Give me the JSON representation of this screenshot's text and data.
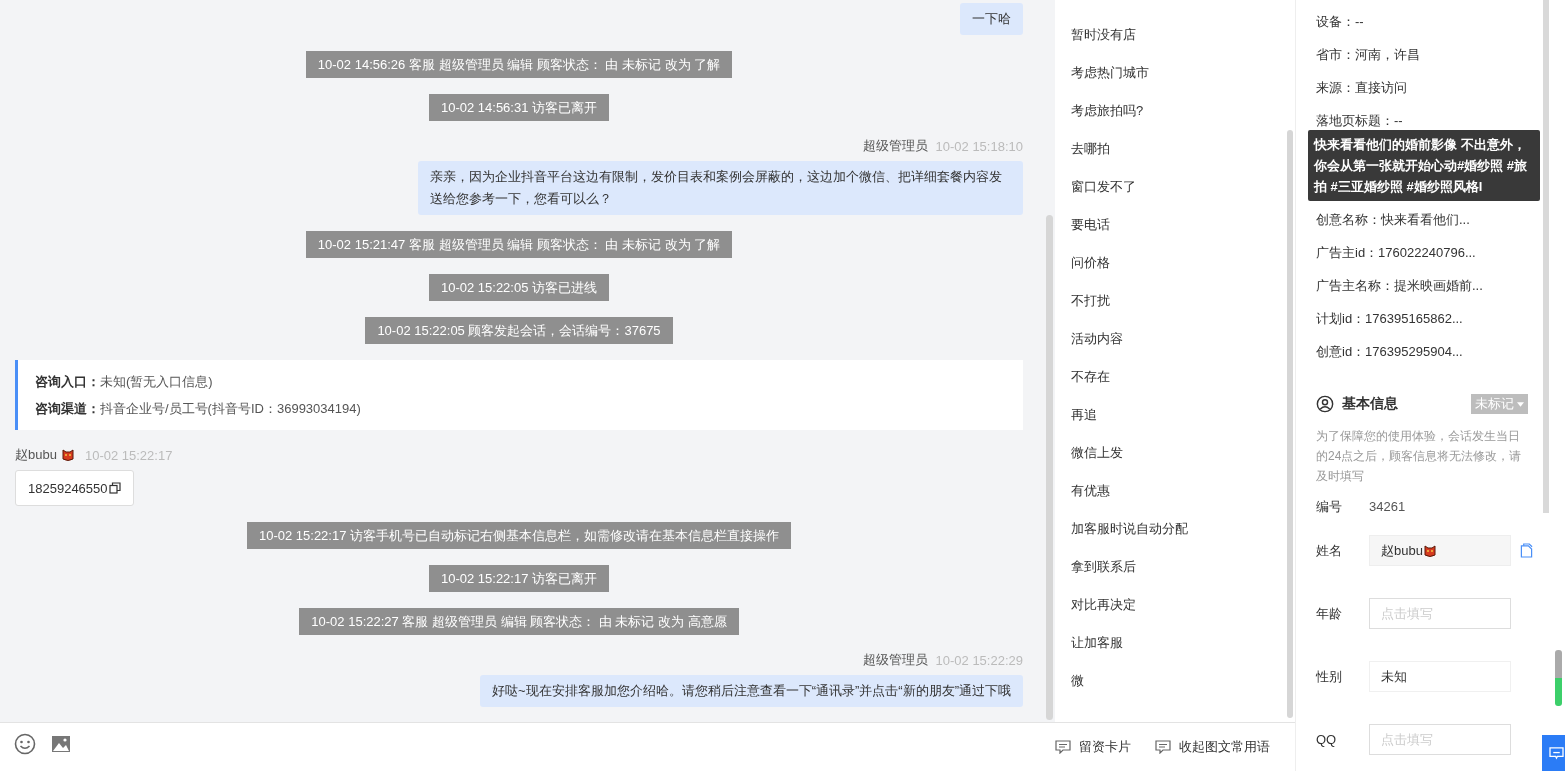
{
  "chat": {
    "messages": [
      {
        "kind": "agent",
        "text": "一下哈"
      },
      {
        "kind": "system",
        "text": "10-02 14:56:26 客服 超级管理员 编辑 顾客状态： 由 未标记 改为 了解"
      },
      {
        "kind": "system",
        "text": "10-02 14:56:31 访客已离开"
      },
      {
        "kind": "agent",
        "sender": "超级管理员",
        "time": "10-02 15:18:10",
        "text": "亲亲，因为企业抖音平台这边有限制，发价目表和案例会屏蔽的，这边加个微信、把详细套餐内容发送给您参考一下，您看可以么？"
      },
      {
        "kind": "system",
        "text": "10-02 15:21:47 客服 超级管理员 编辑 顾客状态： 由 未标记 改为 了解"
      },
      {
        "kind": "system",
        "text": "10-02 15:22:05 访客已进线"
      },
      {
        "kind": "system",
        "text": "10-02 15:22:05 顾客发起会话，会话编号：37675"
      },
      {
        "kind": "info",
        "rows": [
          {
            "label": "咨询入口：",
            "value": "未知(暂无入口信息)"
          },
          {
            "label": "咨询渠道：",
            "value": "抖音企业号/员工号(抖音号ID：36993034194)"
          }
        ]
      },
      {
        "kind": "visitor",
        "sender": "赵bubu",
        "time": "10-02 15:22:17",
        "text": "18259246550"
      },
      {
        "kind": "system",
        "text": "10-02 15:22:17 访客手机号已自动标记右侧基本信息栏，如需修改请在基本信息栏直接操作"
      },
      {
        "kind": "system",
        "text": "10-02 15:22:17 访客已离开"
      },
      {
        "kind": "system",
        "text": "10-02 15:22:27 客服 超级管理员 编辑 顾客状态： 由 未标记 改为 高意愿"
      },
      {
        "kind": "agent",
        "sender": "超级管理员",
        "time": "10-02 15:22:29",
        "text": "好哒~现在安排客服加您介绍哈。请您稍后注意查看一下“通讯录”并点击“新的朋友”通过下哦"
      }
    ]
  },
  "composer": {
    "actions": [
      "留资卡片",
      "收起图文常用语"
    ]
  },
  "phrases": [
    "暂时没有店",
    "考虑热门城市",
    "考虑旅拍吗?",
    "去哪拍",
    "窗口发不了",
    "要电话",
    "问价格",
    "不打扰",
    "活动内容",
    "不存在",
    "再追",
    "微信上发",
    "有优惠",
    "加客服时说自动分配",
    "拿到联系后",
    "对比再决定",
    "让加客服",
    "微"
  ],
  "details": {
    "rows": [
      {
        "text": "设备：--"
      },
      {
        "text": "省市：河南，许昌"
      },
      {
        "text": "来源：直接访问"
      },
      {
        "text": "落地页标题：--"
      },
      {
        "text": "创意名称：快来看看他们..."
      },
      {
        "text": "广告主id：176022240796..."
      },
      {
        "text": "广告主名称：提米映画婚前..."
      },
      {
        "text": "计划id：176395165862..."
      },
      {
        "text": "创意id：176395295904..."
      }
    ],
    "tooltip": "快来看看他们的婚前影像 不出意外，你会从第一张就开始心动#婚纱照 #旅拍 #三亚婚纱照 #婚纱照风格l"
  },
  "basic_info": {
    "title": "基本信息",
    "status": "未标记",
    "note": "为了保障您的使用体验，会话发生当日的24点之后，顾客信息将无法修改，请及时填写",
    "fields": [
      {
        "label": "编号",
        "kind": "text",
        "value": "34261"
      },
      {
        "label": "姓名",
        "kind": "readonly",
        "value": "赵bubu"
      },
      {
        "label": "年龄",
        "kind": "input",
        "placeholder": "点击填写"
      },
      {
        "label": "性别",
        "kind": "select",
        "value": "未知"
      },
      {
        "label": "QQ",
        "kind": "input",
        "placeholder": "点击填写"
      }
    ]
  }
}
